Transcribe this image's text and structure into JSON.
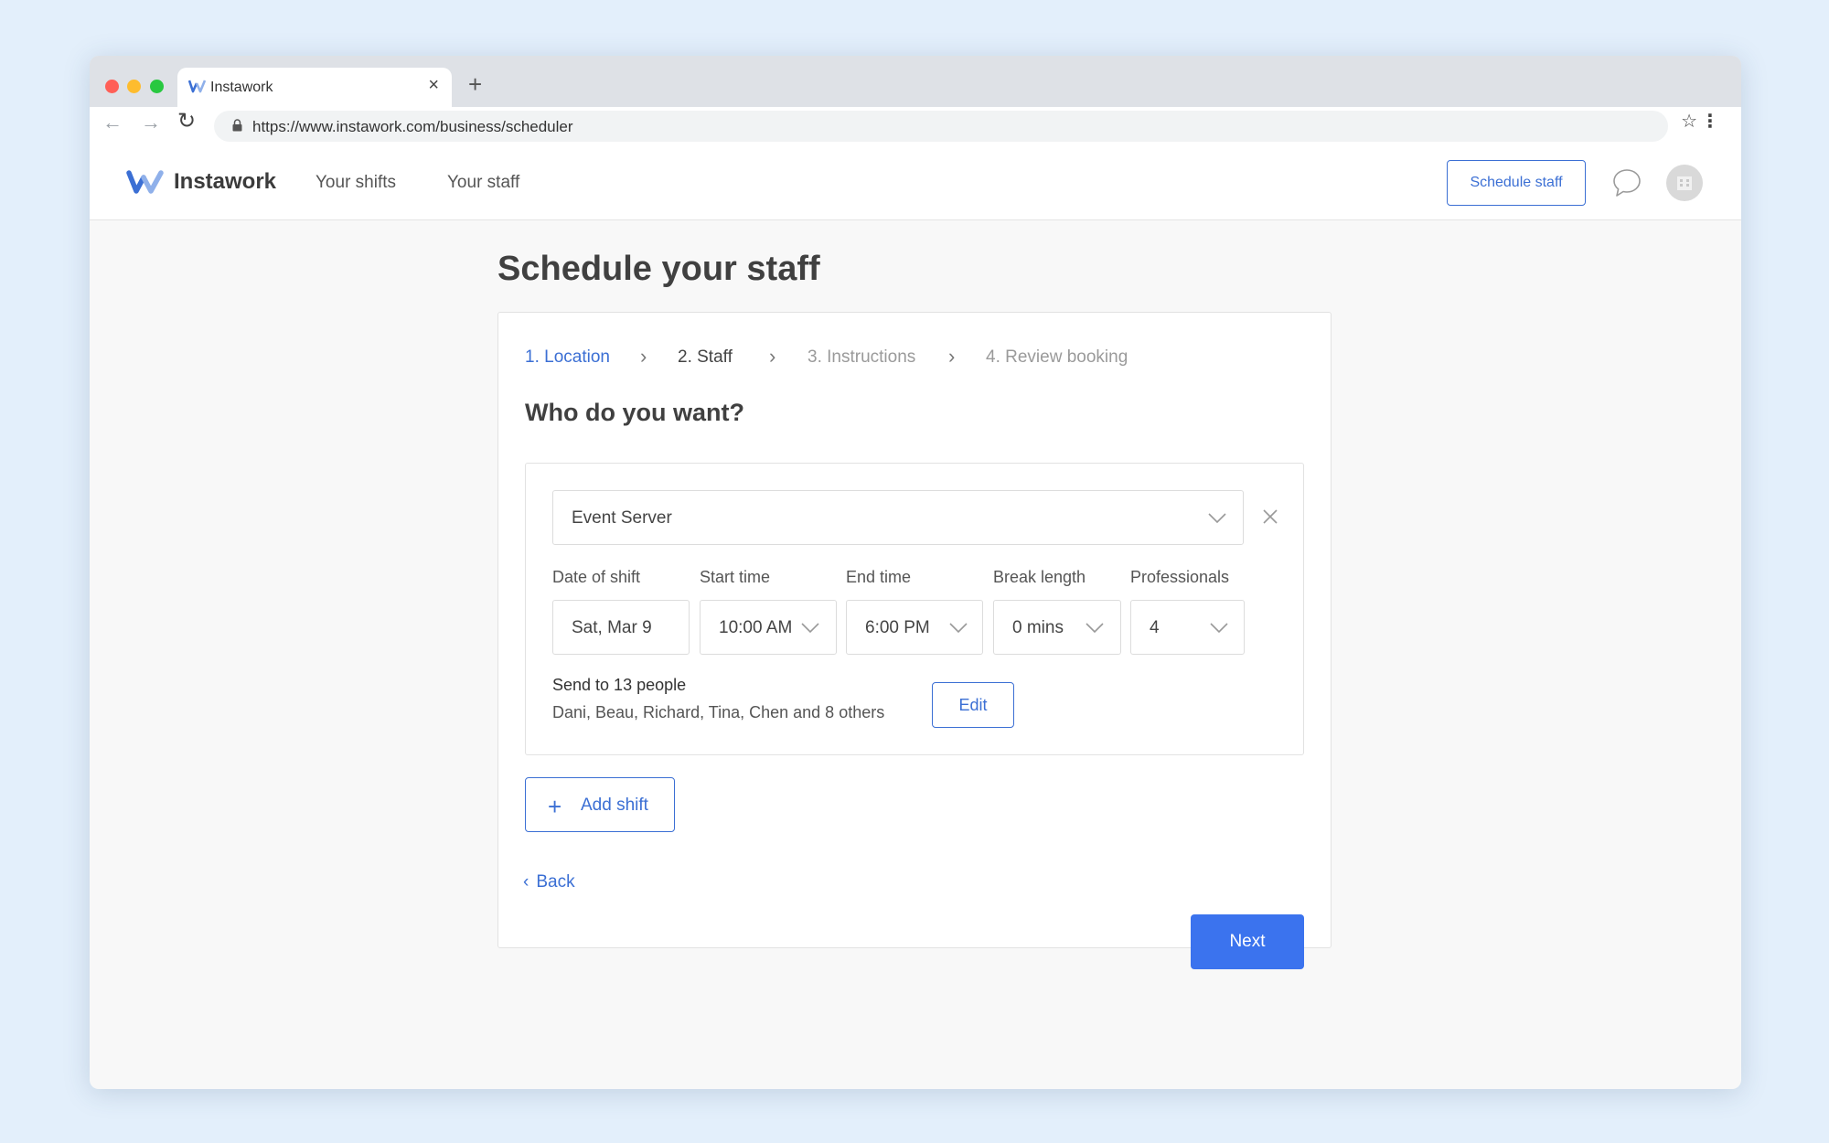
{
  "browser": {
    "tab_title": "Instawork",
    "url": "https://www.instawork.com/business/scheduler",
    "new_tab": "+",
    "close_tab": "×"
  },
  "header": {
    "logo_text": "Instawork",
    "nav": [
      "Your shifts",
      "Your staff"
    ],
    "schedule_button": "Schedule staff"
  },
  "page": {
    "title": "Schedule your staff",
    "steps": [
      "1. Location",
      "2. Staff",
      "3. Instructions",
      "4. Review booking"
    ],
    "active_step": 1,
    "question": "Who do you want?"
  },
  "shift": {
    "role": "Event Server",
    "fields": [
      {
        "label": "Date of shift",
        "value": "Sat, Mar 9"
      },
      {
        "label": "Start time",
        "value": "10:00 AM"
      },
      {
        "label": "End time",
        "value": "6:00 PM"
      },
      {
        "label": "Break length",
        "value": "0 mins"
      },
      {
        "label": "Professionals",
        "value": "4"
      }
    ],
    "send_title": "Send to 13 people",
    "send_names": "Dani, Beau, Richard, Tina, Chen and 8 others",
    "edit_label": "Edit"
  },
  "actions": {
    "add_shift": "Add shift",
    "back": "Back",
    "next": "Next"
  },
  "colors": {
    "accent": "#3b6fd4",
    "primary_button": "#3b73ee",
    "background": "#e3effb"
  }
}
